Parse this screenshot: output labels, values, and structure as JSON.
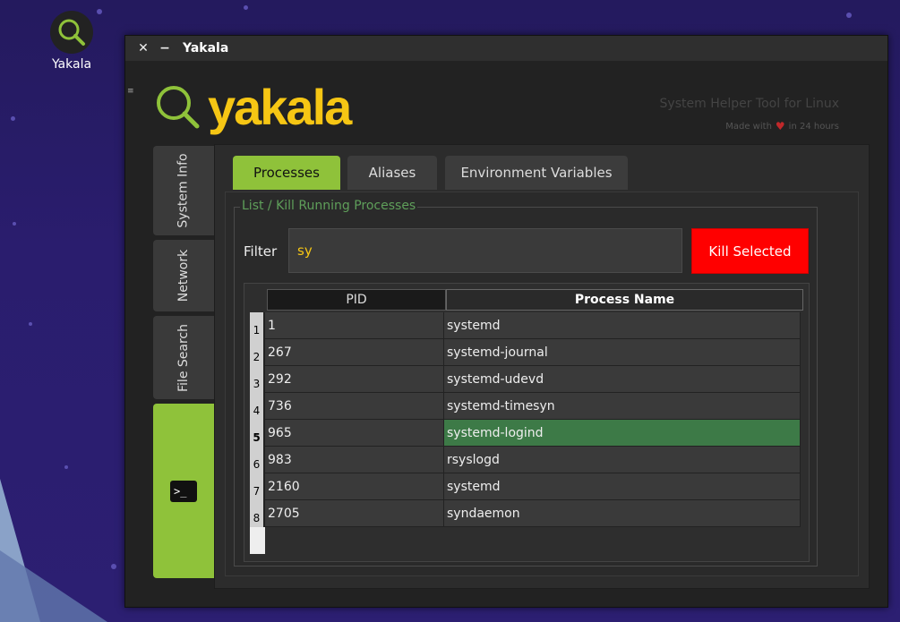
{
  "desktop": {
    "icon_label": "Yakala"
  },
  "window": {
    "title": "Yakala",
    "close_glyph": "✕",
    "minimize_glyph": "−",
    "menu_glyph": "≡"
  },
  "header": {
    "logo_text": "yakala",
    "tagline": "System Helper Tool for Linux",
    "made_with_prefix": "Made with",
    "made_with_suffix": "in 24 hours"
  },
  "side_tabs": [
    {
      "label": "System Info"
    },
    {
      "label": "Network"
    },
    {
      "label": "File Search"
    },
    {
      "label": "",
      "icon": "terminal-icon"
    }
  ],
  "tabs": [
    {
      "label": "Processes",
      "active": true
    },
    {
      "label": "Aliases",
      "active": false
    },
    {
      "label": "Environment Variables",
      "active": false
    }
  ],
  "processes": {
    "group_title": "List / Kill Running Processes",
    "filter_label": "Filter",
    "filter_value": "sy",
    "kill_button": "Kill Selected",
    "columns": [
      "PID",
      "Process Name"
    ],
    "rows": [
      {
        "num": "1",
        "pid": "1",
        "name": "systemd"
      },
      {
        "num": "2",
        "pid": "267",
        "name": "systemd-journal"
      },
      {
        "num": "3",
        "pid": "292",
        "name": "systemd-udevd"
      },
      {
        "num": "4",
        "pid": "736",
        "name": "systemd-timesyn"
      },
      {
        "num": "5",
        "pid": "965",
        "name": "systemd-logind"
      },
      {
        "num": "6",
        "pid": "983",
        "name": "rsyslogd"
      },
      {
        "num": "7",
        "pid": "2160",
        "name": "systemd"
      },
      {
        "num": "8",
        "pid": "2705",
        "name": "syndaemon"
      }
    ],
    "selected_row": 5
  },
  "colors": {
    "accent": "#8fc23a",
    "logo": "#f6c614",
    "kill": "#ff0000",
    "selection": "#3d7a47"
  }
}
